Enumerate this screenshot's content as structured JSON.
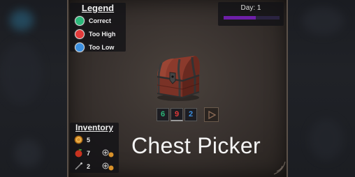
{
  "legend": {
    "title": "Legend",
    "items": [
      {
        "label": "Correct",
        "color": "#2cb77a"
      },
      {
        "label": "Too High",
        "color": "#e23a3a"
      },
      {
        "label": "Too Low",
        "color": "#3b8fe0"
      }
    ]
  },
  "day": {
    "label": "Day: 1",
    "progress": 0.58,
    "bar_color": "#6d1fa8"
  },
  "guess": {
    "digits": [
      {
        "value": "6",
        "color": "#2cb77a"
      },
      {
        "value": "9",
        "color": "#e23a3a"
      },
      {
        "value": "2",
        "color": "#3b8fe0"
      }
    ],
    "selected_index": 1,
    "submit_icon": "play-triangle-icon"
  },
  "inventory": {
    "title": "Inventory",
    "items": [
      {
        "icon": "coin-icon",
        "count": "5"
      },
      {
        "icon": "apple-icon",
        "count": "7"
      },
      {
        "icon": "wand-icon",
        "count": "2"
      }
    ]
  },
  "game_title": "Chest Picker"
}
